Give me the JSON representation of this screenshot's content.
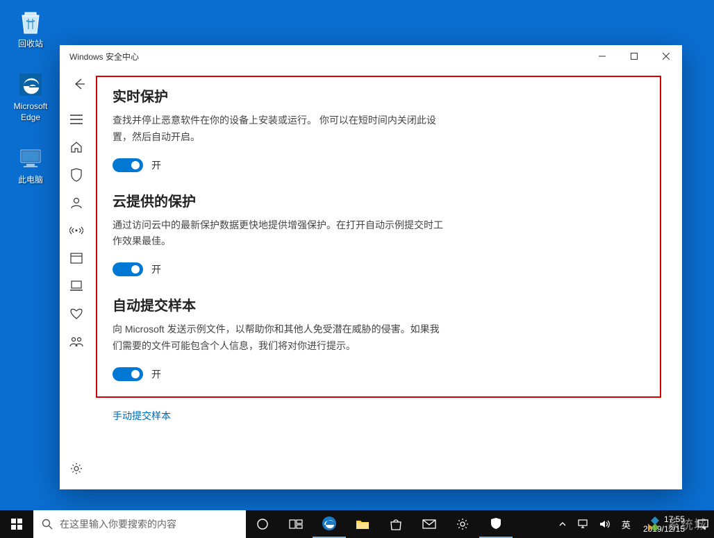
{
  "desktop": {
    "recycle_bin": "回收站",
    "edge": "Microsoft Edge",
    "this_pc": "此电脑"
  },
  "window": {
    "title": "Windows 安全中心",
    "sections": [
      {
        "title": "实时保护",
        "desc": "查找并停止恶意软件在你的设备上安装或运行。 你可以在短时间内关闭此设置，然后自动开启。",
        "toggle_label": "开"
      },
      {
        "title": "云提供的保护",
        "desc": "通过访问云中的最新保护数据更快地提供增强保护。在打开自动示例提交时工作效果最佳。",
        "toggle_label": "开"
      },
      {
        "title": "自动提交样本",
        "desc": "向 Microsoft 发送示例文件，以帮助你和其他人免受潜在威胁的侵害。如果我们需要的文件可能包含个人信息，我们将对你进行提示。",
        "toggle_label": "开"
      }
    ],
    "manual_link": "手动提交样本"
  },
  "taskbar": {
    "search_placeholder": "在这里输入你要搜索的内容",
    "ime": "英",
    "time": "17:55",
    "date": "2019/12/15"
  },
  "watermark": "系统城"
}
